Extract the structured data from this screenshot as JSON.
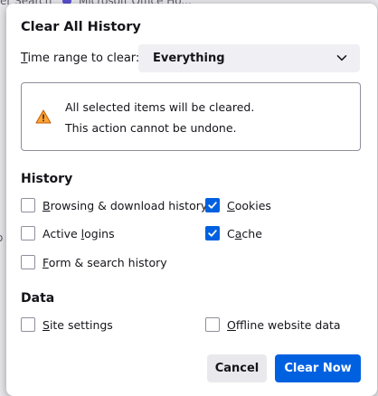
{
  "background": {
    "tab_text": "er Search",
    "tab_title": "Microsoft Office Ho...",
    "left_fragment": "o"
  },
  "dialog": {
    "title": "Clear All History",
    "time_range": {
      "label_prefix": "",
      "label_accel": "T",
      "label_rest": "ime range to clear:",
      "selected": "Everything",
      "icon": "chevron-down-icon"
    },
    "warning": {
      "icon": "warning-icon",
      "line1": "All selected items will be cleared.",
      "line2": "This action cannot be undone."
    },
    "history": {
      "title": "History",
      "items": [
        {
          "accel": "B",
          "rest": "rowsing & download history",
          "checked": false
        },
        {
          "accel": "C",
          "rest": "ookies",
          "checked": true
        },
        {
          "pre": "Active ",
          "accel": "l",
          "rest": "ogins",
          "checked": false
        },
        {
          "pre": "C",
          "accel": "a",
          "rest": "che",
          "checked": true
        },
        {
          "accel": "F",
          "rest": "orm & search history",
          "checked": false
        }
      ]
    },
    "data": {
      "title": "Data",
      "items": [
        {
          "accel": "S",
          "rest": "ite settings",
          "checked": false
        },
        {
          "accel": "O",
          "rest": "ffline website data",
          "checked": false
        }
      ]
    },
    "buttons": {
      "cancel": "Cancel",
      "clear_now": "Clear Now"
    },
    "colors": {
      "accent": "#0061e0",
      "warning": "#ffa436"
    }
  }
}
